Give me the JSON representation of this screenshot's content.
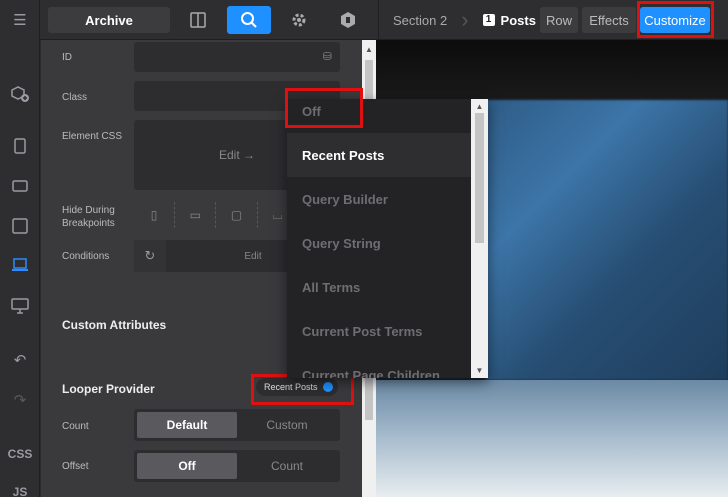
{
  "rail": {
    "items": [
      {
        "icon": "hamburger-icon",
        "glyph": "☰"
      },
      {
        "icon": "add-element-icon",
        "glyph": "⊕"
      },
      {
        "icon": "phone-icon",
        "glyph": "▯"
      },
      {
        "icon": "tablet-landscape-icon",
        "glyph": "▭"
      },
      {
        "icon": "tablet-icon",
        "glyph": "▢"
      },
      {
        "icon": "laptop-icon",
        "glyph": "⌴"
      },
      {
        "icon": "desktop-icon",
        "glyph": "▭"
      },
      {
        "icon": "undo-icon",
        "glyph": "↶"
      },
      {
        "icon": "redo-icon",
        "glyph": "↷"
      }
    ],
    "css_label": "CSS",
    "js_label": "JS"
  },
  "topbar": {
    "archive_label": "Archive",
    "breadcrumb": {
      "section": "Section 2",
      "current_num": "1",
      "current": "Posts"
    },
    "row_label": "Row",
    "effects_label": "Effects",
    "customize_label": "Customize"
  },
  "panel": {
    "id_label": "ID",
    "class_label": "Class",
    "element_css_label": "Element CSS",
    "element_css_edit": "Edit →",
    "hide_label": "Hide During Breakpoints",
    "conditions_label": "Conditions",
    "conditions_edit": "Edit",
    "custom_attributes": "Custom Attributes",
    "looper_provider": "Looper Provider",
    "looper_value": "Recent Posts",
    "count_label": "Count",
    "count_options": [
      "Default",
      "Custom"
    ],
    "offset_label": "Offset",
    "offset_options": [
      "Off",
      "Count"
    ]
  },
  "dropdown": {
    "items": [
      "Off",
      "Recent Posts",
      "Query Builder",
      "Query String",
      "All Terms",
      "Current Post Terms",
      "Current Page Children"
    ],
    "selected": "Recent Posts"
  },
  "colors": {
    "accent": "#1e90ff",
    "highlight": "#e01010"
  }
}
